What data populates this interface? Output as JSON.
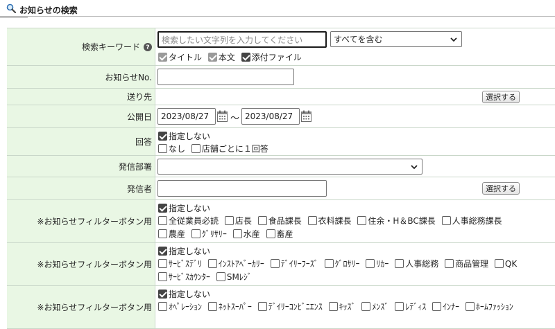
{
  "header": {
    "title": "お知らせの検索",
    "icon": "search-icon"
  },
  "form": {
    "keyword": {
      "label": "検索キーワード",
      "help_icon": "help-icon",
      "placeholder": "検索したい文字列を入力してください",
      "match_select": "すべてを含む",
      "targets": [
        {
          "label": "タイトル",
          "checked": true
        },
        {
          "label": "本文",
          "checked": true
        },
        {
          "label": "添付ファイル",
          "checked": true
        }
      ]
    },
    "notice_no": {
      "label": "お知らせNo.",
      "value": ""
    },
    "recipients": {
      "label": "送り先",
      "button": "選択する"
    },
    "publish_date": {
      "label": "公開日",
      "from": "2023/08/27",
      "separator": "～",
      "to": "2023/08/27"
    },
    "reply": {
      "label": "回答",
      "unspecified": "指定しない",
      "options": [
        "なし",
        "店舗ごとに１回答"
      ]
    },
    "department": {
      "label": "発信部署",
      "value": ""
    },
    "sender": {
      "label": "発信者",
      "value": "",
      "button": "選択する"
    },
    "filters": [
      {
        "label": "※お知らせフィルターボタン用",
        "unspecified": "指定しない",
        "lines": [
          [
            "全従業員必読",
            "店長",
            "食品課長",
            "衣料課長",
            "住余・H＆BC課長",
            "人事総務課長"
          ],
          [
            "農産",
            "ｸﾞﾘｻﾘｰ",
            "水産",
            "畜産"
          ]
        ]
      },
      {
        "label": "※お知らせフィルターボタン用",
        "unspecified": "指定しない",
        "lines": [
          [
            "ｻｰﾋﾞｽﾃﾞﾘ",
            "ｲﾝｽﾄｱﾍﾞｰｶﾘｰ",
            "ﾃﾞｲﾘｰﾌｰｽﾞ",
            "ｸﾞﾛｻﾘｰ",
            "ﾘｶｰ",
            "人事総務",
            "商品管理",
            "QK"
          ],
          [
            "ｻｰﾋﾞｽｶｳﾝﾀｰ",
            "SMﾚｼﾞ"
          ]
        ]
      },
      {
        "label": "※お知らせフィルターボタン用",
        "unspecified": "指定しない",
        "lines": [
          [
            "ｵﾍﾟﾚｰｼｮﾝ",
            "ﾈｯﾄｽｰﾊﾟｰ",
            "ﾃﾞｲﾘｰｺﾝﾋﾞﾆｴﾝｽ",
            "ｷｯｽﾞ",
            "ﾒﾝｽﾞ",
            "ﾚﾃﾞｨｽ",
            "ｲﾝﾅｰ",
            "ﾎｰﾑﾌｧｯｼｮﾝ"
          ]
        ]
      }
    ]
  }
}
